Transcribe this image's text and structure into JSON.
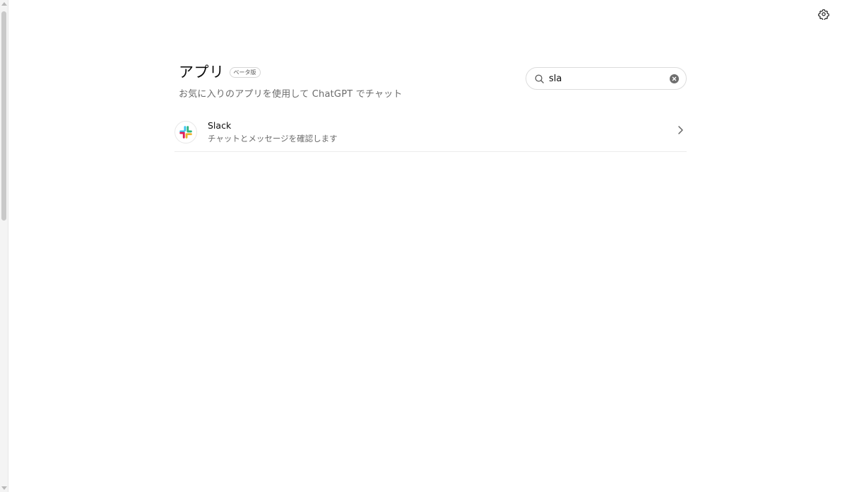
{
  "header": {
    "title": "アプリ",
    "badge": "ベータ版",
    "subtitle": "お気に入りのアプリを使用して ChatGPT でチャット"
  },
  "search": {
    "value": "sla",
    "icon": "search-icon",
    "clear_icon": "clear-icon"
  },
  "toolbar": {
    "settings_icon": "gear-icon"
  },
  "results": [
    {
      "name": "Slack",
      "description": "チャットとメッセージを確認します",
      "icon": "slack-logo",
      "chevron": "chevron-right-icon"
    }
  ],
  "colors": {
    "slack_blue": "#36C5F0",
    "slack_green": "#2EB67D",
    "slack_yellow": "#ECB22E",
    "slack_red": "#E01E5A"
  }
}
